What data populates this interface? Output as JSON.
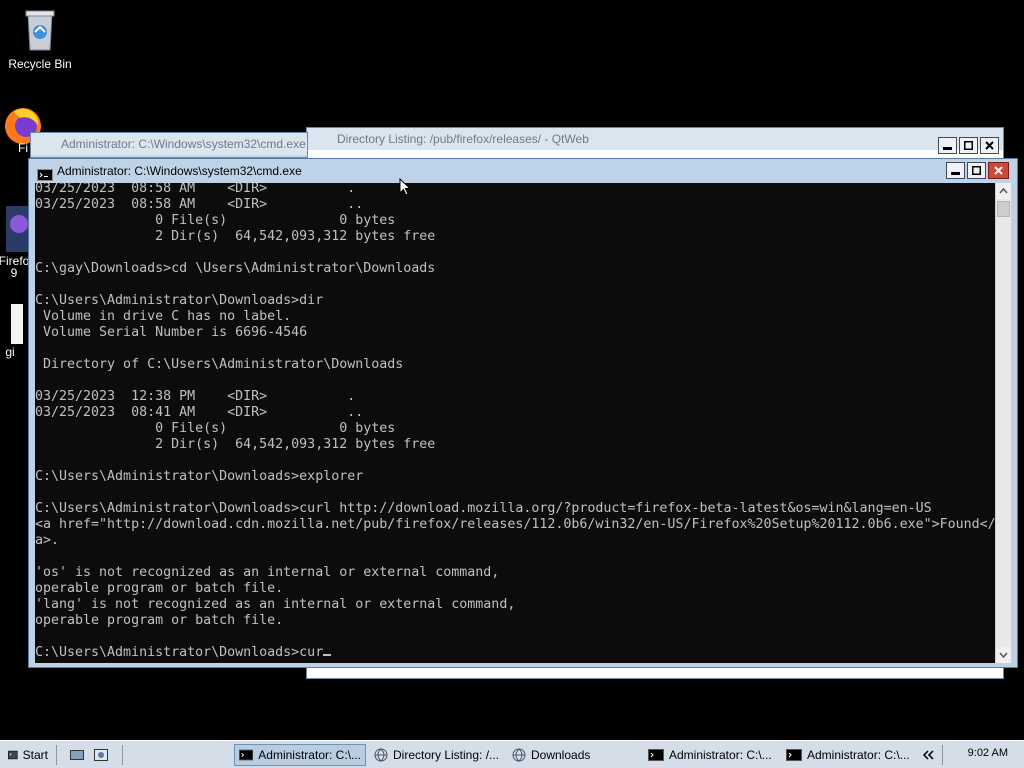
{
  "desktop": {
    "icons": [
      {
        "label": "Recycle Bin"
      },
      {
        "label": "Fi"
      },
      {
        "label": "Firefo\n9"
      },
      {
        "label": "gi"
      }
    ]
  },
  "background_windows": {
    "cmd_title": "Administrator: C:\\Windows\\system32\\cmd.exe",
    "browser_title": "Directory Listing: /pub/firefox/releases/ - QtWeb"
  },
  "console": {
    "title": "Administrator: C:\\Windows\\system32\\cmd.exe",
    "lines": [
      "03/25/2023  08:58 AM    <DIR>          .",
      "03/25/2023  08:58 AM    <DIR>          ..",
      "               0 File(s)              0 bytes",
      "               2 Dir(s)  64,542,093,312 bytes free",
      "",
      "C:\\gay\\Downloads>cd \\Users\\Administrator\\Downloads",
      "",
      "C:\\Users\\Administrator\\Downloads>dir",
      " Volume in drive C has no label.",
      " Volume Serial Number is 6696-4546",
      "",
      " Directory of C:\\Users\\Administrator\\Downloads",
      "",
      "03/25/2023  12:38 PM    <DIR>          .",
      "03/25/2023  08:41 AM    <DIR>          ..",
      "               0 File(s)              0 bytes",
      "               2 Dir(s)  64,542,093,312 bytes free",
      "",
      "C:\\Users\\Administrator\\Downloads>explorer",
      "",
      "C:\\Users\\Administrator\\Downloads>curl http://download.mozilla.org/?product=firefox-beta-latest&os=win&lang=en-US",
      "<a href=\"http://download.cdn.mozilla.net/pub/firefox/releases/112.0b6/win32/en-US/Firefox%20Setup%20112.0b6.exe\">Found</",
      "a>.",
      "",
      "'os' is not recognized as an internal or external command,",
      "operable program or batch file.",
      "'lang' is not recognized as an internal or external command,",
      "operable program or batch file.",
      ""
    ],
    "prompt_line": "C:\\Users\\Administrator\\Downloads>cur"
  },
  "taskbar": {
    "start_label": "Start",
    "items": [
      {
        "label": "Administrator: C:\\..."
      },
      {
        "label": "Directory Listing: /..."
      },
      {
        "label": "Downloads"
      },
      {
        "label": "Administrator: C:\\..."
      },
      {
        "label": "Administrator: C:\\..."
      }
    ],
    "clock": "9:02 AM"
  }
}
